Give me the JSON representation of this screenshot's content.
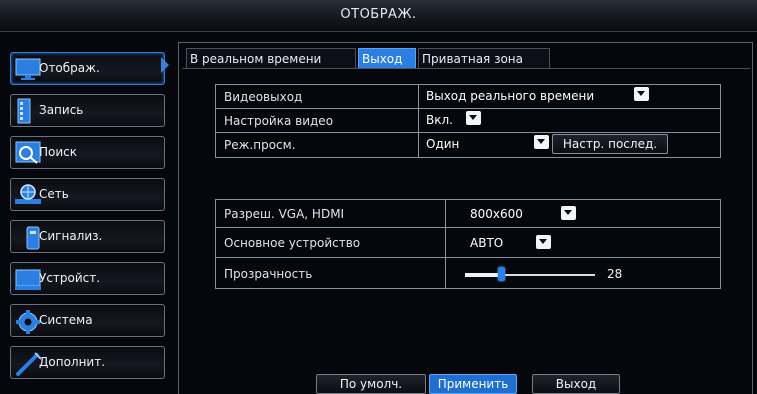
{
  "window": {
    "title": "ОТОБРАЖ."
  },
  "sidebar": {
    "items": [
      {
        "label": "Отображ.",
        "icon": "monitor-icon",
        "active": true
      },
      {
        "label": "Запись",
        "icon": "record-icon"
      },
      {
        "label": "Поиск",
        "icon": "search-icon"
      },
      {
        "label": "Сеть",
        "icon": "network-icon"
      },
      {
        "label": "Сигнализ.",
        "icon": "alarm-icon"
      },
      {
        "label": "Устройст.",
        "icon": "device-icon"
      },
      {
        "label": "Система",
        "icon": "gear-icon"
      },
      {
        "label": "Дополнит.",
        "icon": "tools-icon"
      }
    ]
  },
  "tabs": [
    {
      "label": "В реальном времени"
    },
    {
      "label": "Выход",
      "active": true
    },
    {
      "label": "Приватная зона"
    }
  ],
  "section1": {
    "video_output": {
      "label": "Видеовыход",
      "value": "Выход реального времени"
    },
    "video_setting": {
      "label": "Настройка видео",
      "value": "Вкл."
    },
    "view_mode": {
      "label": "Реж.просм.",
      "value": "Один",
      "button": "Настр. послед."
    }
  },
  "section2": {
    "resolution": {
      "label": "Разреш. VGA, HDMI",
      "value": "800x600"
    },
    "main_device": {
      "label": "Основное устройство",
      "value": "АВТО"
    },
    "transparency": {
      "label": "Прозрачность",
      "value": "28",
      "level": 0.28
    }
  },
  "footer": {
    "default_label": "По умолч.",
    "apply_label": "Применить",
    "exit_label": "Выход"
  },
  "colors": {
    "accent": "#2a7fe0",
    "background": "#05070d",
    "border": "#8a8f9c"
  }
}
